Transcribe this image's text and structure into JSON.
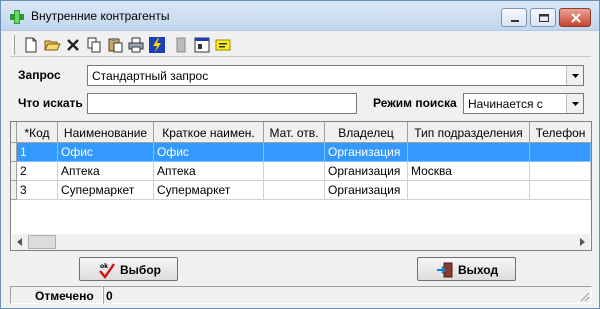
{
  "window": {
    "title": "Внутренние контрагенты"
  },
  "toolbar": {
    "icons": [
      "new-document-icon",
      "open-folder-icon",
      "delete-icon",
      "copy-icon",
      "paste-icon",
      "print-icon",
      "lightning-icon",
      "info-icon",
      "window-icon",
      "note-icon"
    ]
  },
  "query": {
    "label": "Запрос",
    "value": "Стандартный запрос"
  },
  "search": {
    "label": "Что искать",
    "value": "",
    "mode_label": "Режим поиска",
    "mode_value": "Начинается с"
  },
  "grid": {
    "columns": [
      "*Код",
      "Наименование",
      "Краткое наимен.",
      "Мат. отв.",
      "Владелец",
      "Тип подразделения",
      "Телефон"
    ],
    "rows": [
      [
        "1",
        "Офис",
        "Офис",
        "",
        "Организация",
        "",
        ""
      ],
      [
        "2",
        "Аптека",
        "Аптека",
        "",
        "Организация",
        "Москва",
        ""
      ],
      [
        "3",
        "Супермаркет",
        "Супермаркет",
        "",
        "Организация",
        "",
        ""
      ]
    ],
    "selected_row": 0
  },
  "buttons": {
    "select_label": "Выбор",
    "exit_label": "Выход"
  },
  "status": {
    "marked_label": "Отмечено",
    "marked_value": "0"
  }
}
